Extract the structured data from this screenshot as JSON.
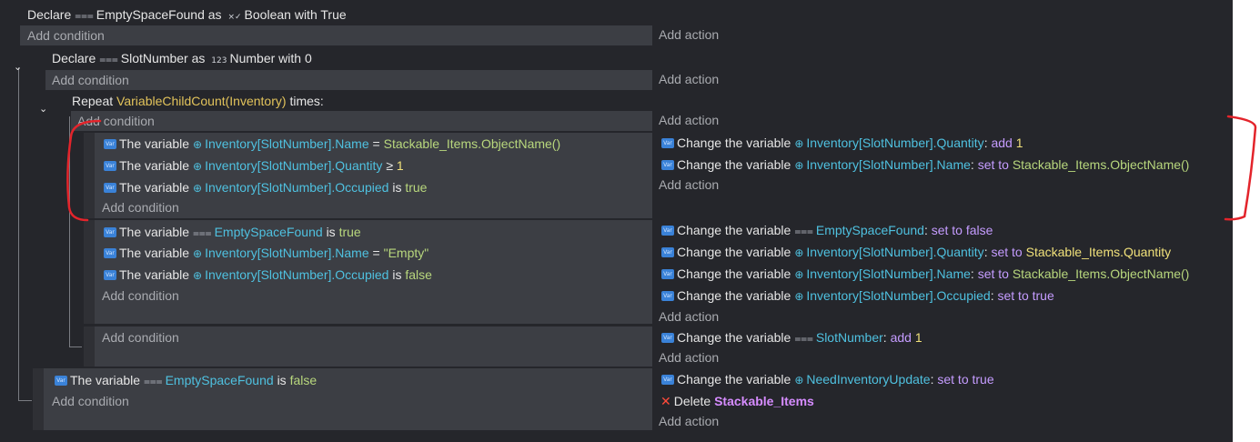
{
  "common": {
    "add_condition": "Add condition",
    "add_action": "Add action",
    "the_variable": "The variable",
    "change_the_variable": "Change the variable",
    "var_icon_text": "Var"
  },
  "event1": {
    "declare": "Declare",
    "var_name": "EmptySpaceFound",
    "as": "as",
    "type": "Boolean",
    "with": "with",
    "value": "True"
  },
  "event2": {
    "declare": "Declare",
    "var_name": "SlotNumber",
    "as": "as",
    "type_icon": "123",
    "type": "Number",
    "with": "with",
    "value": "0"
  },
  "repeat": {
    "repeat": "Repeat",
    "expression": "VariableChildCount(Inventory)",
    "times": "times:"
  },
  "sub1": {
    "conditions": [
      {
        "var": "Inventory[SlotNumber].Name",
        "op": "=",
        "value": "Stackable_Items.ObjectName()"
      },
      {
        "var": "Inventory[SlotNumber].Quantity",
        "op": "≥",
        "value": "1"
      },
      {
        "var": "Inventory[SlotNumber].Occupied",
        "op": "is",
        "value": "true"
      }
    ],
    "actions": [
      {
        "var": "Inventory[SlotNumber].Quantity",
        "op": "add",
        "value": "1"
      },
      {
        "var": "Inventory[SlotNumber].Name",
        "op": "set to",
        "value": "Stackable_Items.ObjectName()"
      }
    ]
  },
  "sub2": {
    "conditions": [
      {
        "var": "EmptySpaceFound",
        "op": "is",
        "value": "true"
      },
      {
        "var": "Inventory[SlotNumber].Name",
        "op": "=",
        "value": "\"Empty\""
      },
      {
        "var": "Inventory[SlotNumber].Occupied",
        "op": "is",
        "value": "false"
      }
    ],
    "actions": [
      {
        "var": "EmptySpaceFound",
        "op": "set to false"
      },
      {
        "var": "Inventory[SlotNumber].Quantity",
        "op": "set to",
        "value": "Stackable_Items.Quantity"
      },
      {
        "var": "Inventory[SlotNumber].Name",
        "op": "set to",
        "value": "Stackable_Items.ObjectName()"
      },
      {
        "var": "Inventory[SlotNumber].Occupied",
        "op": "set to true"
      }
    ]
  },
  "sub3": {
    "actions": [
      {
        "var": "SlotNumber",
        "op": "add",
        "value": "1"
      }
    ]
  },
  "sub4": {
    "conditions": [
      {
        "var": "EmptySpaceFound",
        "op": "is",
        "value": "false"
      }
    ],
    "actions": [
      {
        "var": "NeedInventoryUpdate",
        "op": "set to true"
      }
    ],
    "delete": {
      "label": "Delete",
      "object": "Stackable_Items"
    }
  },
  "colors": {
    "background": "#25262b",
    "condition_panel": "#3c3e44",
    "action_panel": "#2f3035",
    "variable": "#4fc1e0",
    "string": "#b8d77d",
    "operator": "#c59cff",
    "number": "#f0e07a",
    "annotation": "#e3242b"
  }
}
